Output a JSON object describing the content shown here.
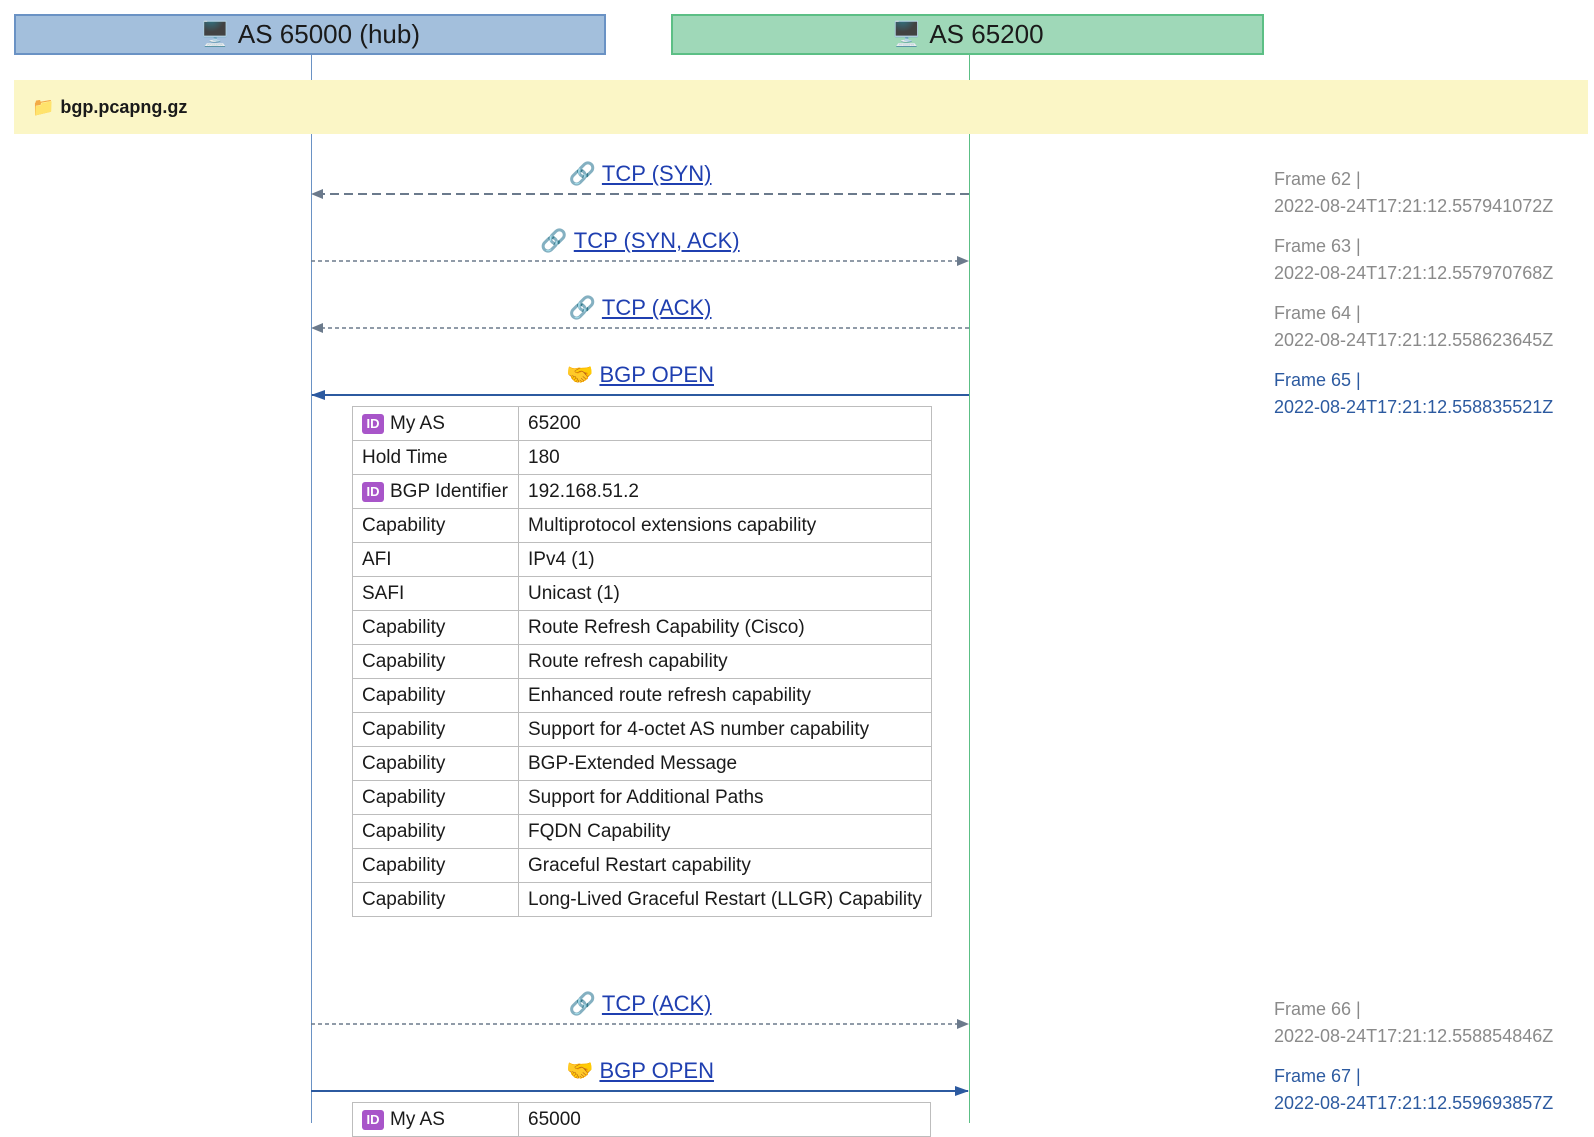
{
  "participants": {
    "hub": {
      "icon": "🖥️",
      "label": "AS 65000 (hub)"
    },
    "peer": {
      "icon": "🖥️",
      "label": "AS 65200"
    }
  },
  "file": {
    "icon": "📁",
    "name": "bgp.pcapng.gz"
  },
  "messages": [
    {
      "icon": "🔗",
      "label": "TCP (SYN)",
      "frame": "Frame 62 |",
      "time": "2022-08-24T17:21:12.557941072Z"
    },
    {
      "icon": "🔗",
      "label": "TCP (SYN, ACK)",
      "frame": "Frame 63 |",
      "time": "2022-08-24T17:21:12.557970768Z"
    },
    {
      "icon": "🔗",
      "label": "TCP (ACK)",
      "frame": "Frame 64 |",
      "time": "2022-08-24T17:21:12.558623645Z"
    },
    {
      "icon": "🤝",
      "label": "BGP OPEN",
      "frame": "Frame 65 |",
      "time": "2022-08-24T17:21:12.558835521Z"
    },
    {
      "icon": "🔗",
      "label": "TCP (ACK)",
      "frame": "Frame 66 |",
      "time": "2022-08-24T17:21:12.558854846Z"
    },
    {
      "icon": "🤝",
      "label": "BGP OPEN",
      "frame": "Frame 67 |",
      "time": "2022-08-24T17:21:12.559693857Z"
    }
  ],
  "open_1_rows": [
    {
      "id": true,
      "key": "My AS",
      "value": "65200"
    },
    {
      "id": false,
      "key": "Hold Time",
      "value": "180"
    },
    {
      "id": true,
      "key": "BGP Identifier",
      "value": "192.168.51.2"
    },
    {
      "id": false,
      "key": "Capability",
      "value": "Multiprotocol extensions capability"
    },
    {
      "id": false,
      "key": "AFI",
      "value": "IPv4 (1)"
    },
    {
      "id": false,
      "key": "SAFI",
      "value": "Unicast (1)"
    },
    {
      "id": false,
      "key": "Capability",
      "value": "Route Refresh Capability (Cisco)"
    },
    {
      "id": false,
      "key": "Capability",
      "value": "Route refresh capability"
    },
    {
      "id": false,
      "key": "Capability",
      "value": "Enhanced route refresh capability"
    },
    {
      "id": false,
      "key": "Capability",
      "value": "Support for 4-octet AS number capability"
    },
    {
      "id": false,
      "key": "Capability",
      "value": "BGP-Extended Message"
    },
    {
      "id": false,
      "key": "Capability",
      "value": "Support for Additional Paths"
    },
    {
      "id": false,
      "key": "Capability",
      "value": "FQDN Capability"
    },
    {
      "id": false,
      "key": "Capability",
      "value": "Graceful Restart capability"
    },
    {
      "id": false,
      "key": "Capability",
      "value": "Long-Lived Graceful Restart (LLGR) Capability"
    }
  ],
  "open_2_rows": [
    {
      "id": true,
      "key": "My AS",
      "value": "65000"
    }
  ],
  "id_badge": "ID",
  "colors": {
    "hub": "#6a92c4",
    "peer": "#5cbf85",
    "tcp_arrow": "#6b7a8c",
    "bgp_arrow": "#2c5aa0",
    "file_bar": "#fbf6c6"
  }
}
